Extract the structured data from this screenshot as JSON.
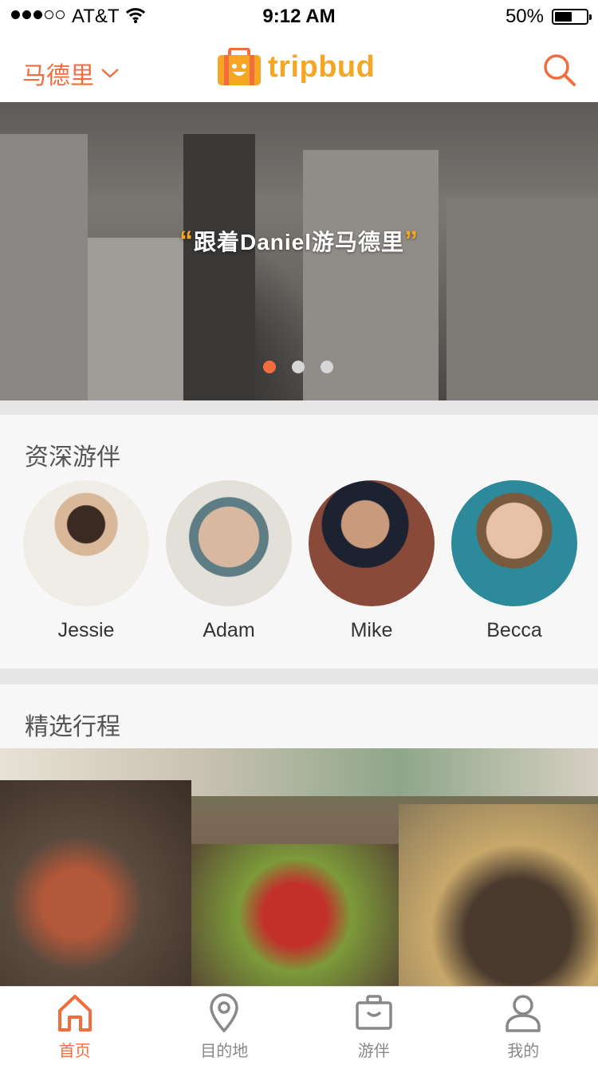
{
  "status_bar": {
    "carrier": "AT&T",
    "time": "9:12 AM",
    "battery": "50%",
    "battery_level": 0.5,
    "signal_bars": 3
  },
  "header": {
    "city": "马德里",
    "logo_text": "tripbud"
  },
  "banner": {
    "quote": "跟着Daniel游马德里",
    "slides": 3,
    "active_slide": 0
  },
  "guides_section": {
    "title": "资深游伴",
    "guides": [
      {
        "name": "Jessie"
      },
      {
        "name": "Adam"
      },
      {
        "name": "Mike"
      },
      {
        "name": "Becca"
      }
    ]
  },
  "trips_section": {
    "title": "精选行程"
  },
  "tabs": [
    {
      "label": "首页",
      "icon": "home-icon",
      "active": true
    },
    {
      "label": "目的地",
      "icon": "location-pin-icon",
      "active": false
    },
    {
      "label": "游伴",
      "icon": "briefcase-icon",
      "active": false
    },
    {
      "label": "我的",
      "icon": "user-icon",
      "active": false
    }
  ],
  "colors": {
    "accent": "#f26d3d",
    "logo": "#f5a623",
    "inactive": "#888888"
  }
}
